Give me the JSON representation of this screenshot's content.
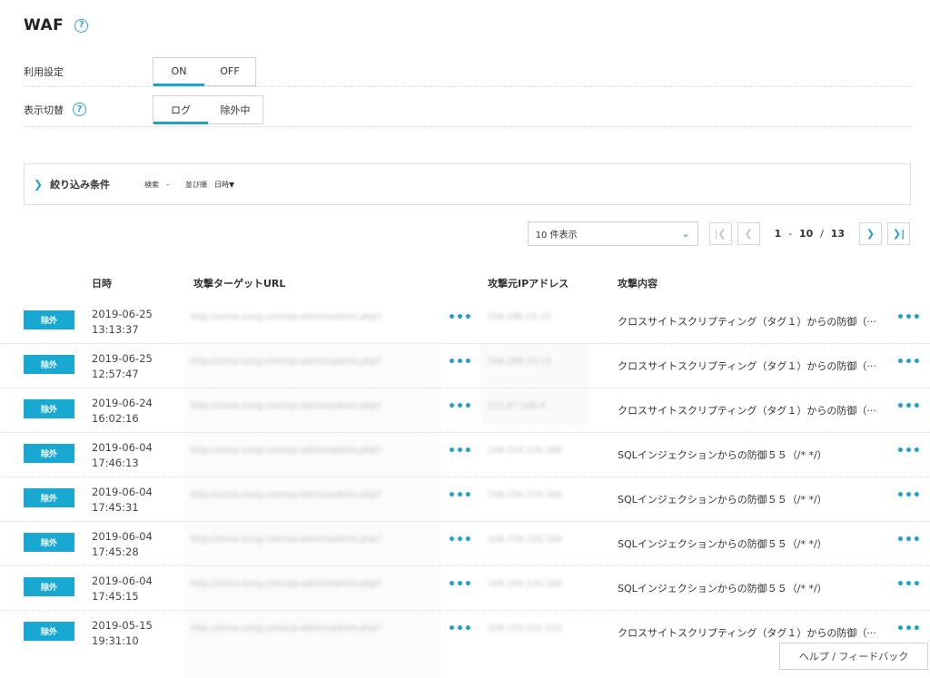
{
  "page": {
    "title": "WAF",
    "help_glyph": "?"
  },
  "settings": {
    "usage_label": "利用設定",
    "usage_options": [
      "ON",
      "OFF"
    ],
    "usage_selected": "ON",
    "display_label": "表示切替",
    "display_options": [
      "ログ",
      "除外中"
    ],
    "display_selected": "ログ"
  },
  "filter": {
    "title": "絞り込み条件",
    "search_label": "検索",
    "search_value": "-",
    "sort_label": "並び順",
    "sort_value": "日時▼"
  },
  "pagination": {
    "per_page": "10 件表示",
    "range_start": "1",
    "range_dash": "-",
    "range_end": "10",
    "total_sep": "/",
    "total": "13"
  },
  "table": {
    "columns": [
      "日時",
      "攻撃ターゲットURL",
      "攻撃元IPアドレス",
      "攻撃内容"
    ],
    "rows": [
      {
        "action": "除外",
        "date": "2019-06-25",
        "time": "13:13:37",
        "url": "http://xnna-xxng.com/xp-admin/admin.php?",
        "ip": "106.180.15.13",
        "attack": "クロスサイトスクリプティング（タグ１）からの防御（···"
      },
      {
        "action": "除外",
        "date": "2019-06-25",
        "time": "12:57:47",
        "url": "http://xnna-xxng.com/xp-admin/admin.php?",
        "ip": "106.180.15.13",
        "attack": "クロスサイトスクリプティング（タグ１）からの防御（···"
      },
      {
        "action": "除外",
        "date": "2019-06-24",
        "time": "16:02:16",
        "url": "http://xnna-xxng.com/xp-admin/admin.php?",
        "ip": "111.87.166.4",
        "attack": "クロスサイトスクリプティング（タグ１）からの防御（···"
      },
      {
        "action": "除外",
        "date": "2019-06-04",
        "time": "17:46:13",
        "url": "http://xnna-xxng.com/xp-admin/admin.php?",
        "ip": "106.154.120.166",
        "attack": "SQLインジェクションからの防御５５（/* */）"
      },
      {
        "action": "除外",
        "date": "2019-06-04",
        "time": "17:45:31",
        "url": "http://xnna-xxng.com/xp-admin/admin.php?",
        "ip": "106.154.120.166",
        "attack": "SQLインジェクションからの防御５５（/* */）"
      },
      {
        "action": "除外",
        "date": "2019-06-04",
        "time": "17:45:28",
        "url": "http://xnna-xxng.com/xp-admin/admin.php?",
        "ip": "106.154.120.166",
        "attack": "SQLインジェクションからの防御５５（/* */）"
      },
      {
        "action": "除外",
        "date": "2019-06-04",
        "time": "17:45:15",
        "url": "http://xnna-xxng.com/xp-admin/admin.php?",
        "ip": "106.154.120.166",
        "attack": "SQLインジェクションからの防御５５（/* */）"
      },
      {
        "action": "除外",
        "date": "2019-05-15",
        "time": "19:31:10",
        "url": "http://xnna-xxng.com/xp-admin/admin.php?",
        "ip": "106.153.121.113",
        "attack": "クロスサイトスクリプティング（タグ１）からの防御（···"
      }
    ]
  },
  "footer": {
    "help_feedback": "ヘルプ / フィードバック"
  },
  "colors": {
    "accent": "#1aa3cc",
    "badge": "#18a8d2"
  },
  "icons": {
    "more": "more-dots-icon",
    "help": "help-circle-icon",
    "chevron": "chevron-right-icon"
  }
}
